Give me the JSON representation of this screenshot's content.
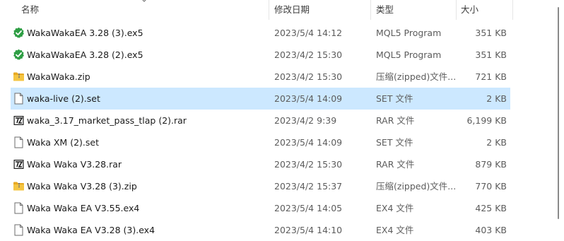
{
  "columns": {
    "name": "名称",
    "date": "修改日期",
    "type": "类型",
    "size": "大小"
  },
  "rows": [
    {
      "icon": "mql5-executable-icon",
      "name": "WakaWakaEA 3.28 (3).ex5",
      "date": "2023/5/4 14:12",
      "type": "MQL5 Program",
      "size": "351 KB",
      "state": "normal"
    },
    {
      "icon": "mql5-executable-icon",
      "name": "WakaWakaEA 3.28 (2).ex5",
      "date": "2023/4/2 15:30",
      "type": "MQL5 Program",
      "size": "351 KB",
      "state": "normal"
    },
    {
      "icon": "zip-folder-icon",
      "name": "WakaWaka.zip",
      "date": "2023/4/2 15:30",
      "type": "压缩(zipped)文件...",
      "size": "721 KB",
      "state": "normal"
    },
    {
      "icon": "file-icon",
      "name": "waka-live (2).set",
      "date": "2023/5/4 14:09",
      "type": "SET 文件",
      "size": "2 KB",
      "state": "selected"
    },
    {
      "icon": "7zip-archive-icon",
      "name": "waka_3.17_market_pass_tlap (2).rar",
      "date": "2023/4/2 9:39",
      "type": "RAR 文件",
      "size": "6,199 KB",
      "state": "normal"
    },
    {
      "icon": "file-icon",
      "name": "Waka XM (2).set",
      "date": "2023/5/4 14:09",
      "type": "SET 文件",
      "size": "2 KB",
      "state": "normal"
    },
    {
      "icon": "7zip-archive-icon",
      "name": "Waka Waka V3.28.rar",
      "date": "2023/4/2 15:30",
      "type": "RAR 文件",
      "size": "879 KB",
      "state": "normal"
    },
    {
      "icon": "zip-folder-icon",
      "name": "Waka Waka V3.28 (3).zip",
      "date": "2023/4/2 15:37",
      "type": "压缩(zipped)文件...",
      "size": "770 KB",
      "state": "normal"
    },
    {
      "icon": "file-icon",
      "name": "Waka Waka EA V3.55.ex4",
      "date": "2023/5/4 14:05",
      "type": "EX4 文件",
      "size": "425 KB",
      "state": "normal"
    },
    {
      "icon": "file-icon",
      "name": "Waka Waka EA V3.28 (3).ex4",
      "date": "2023/5/4 14:10",
      "type": "EX4 文件",
      "size": "403 KB",
      "state": "normal"
    }
  ],
  "colors": {
    "selected_row": "#cce8ff",
    "mql5_green": "#2e9e44",
    "zip_yellow": "#f4c542"
  }
}
